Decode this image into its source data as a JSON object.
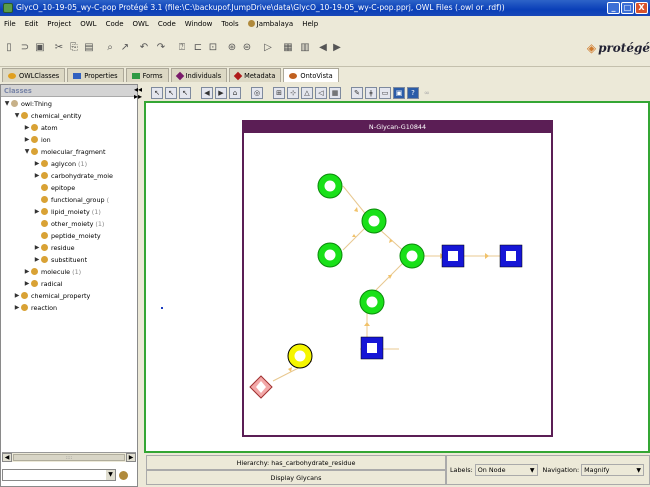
{
  "window": {
    "title": "GlycO_10-19-05_wy-C-pop  Protégé 3.1   (file:\\C:\\backupof.JumpDrive\\data\\GlycO_10-19-05_wy-C-pop.pprj, OWL Files (.owl or .rdf))",
    "minimize": "_",
    "maximize": "□",
    "close": "X"
  },
  "menu": [
    "File",
    "Edit",
    "Project",
    "OWL",
    "Code",
    "OWL",
    "Code",
    "Window",
    "Tools",
    "Jambalaya",
    "Help"
  ],
  "logo": "protégé",
  "tabs": [
    {
      "label": "OWLClasses",
      "color": "#e0a020"
    },
    {
      "label": "Properties",
      "color": "#3060c0"
    },
    {
      "label": "Forms",
      "color": "#2e9a45"
    },
    {
      "label": "Individuals",
      "color": "#7a1a6a"
    },
    {
      "label": "Metadata",
      "color": "#b01a1a"
    },
    {
      "label": "OntoVista",
      "color": "#c06020"
    }
  ],
  "left_panel": {
    "header": "Classes",
    "tree": [
      {
        "label": "owl:Thing",
        "expanded": true
      },
      {
        "label": "chemical_entity",
        "expanded": true
      },
      {
        "label": "atom"
      },
      {
        "label": "ion"
      },
      {
        "label": "molecular_fragment",
        "expanded": true
      },
      {
        "label": "aglycon",
        "count": "(1)"
      },
      {
        "label": "carbohydrate_moie"
      },
      {
        "label": "epitope"
      },
      {
        "label": "functional_group",
        "count": "("
      },
      {
        "label": "lipid_moiety",
        "count": "(1)"
      },
      {
        "label": "other_moiety",
        "count": "(1)"
      },
      {
        "label": "peptide_moiety"
      },
      {
        "label": "residue"
      },
      {
        "label": "substituent"
      },
      {
        "label": "molecule",
        "count": "(1)"
      },
      {
        "label": "radical"
      },
      {
        "label": "chemical_property"
      },
      {
        "label": "reaction"
      }
    ],
    "scroll_thumb_label": "::::"
  },
  "canvas": {
    "glycan_title": "N-Glycan-G10844"
  },
  "status": {
    "hierarchy": "Hierarchy: has_carbohydrate_residue",
    "display_button": "Display Glycans",
    "labels_label": "Labels:",
    "labels_value": "On Node",
    "navigation_label": "Navigation:",
    "navigation_value": "Magnify"
  },
  "colors": {
    "green_node": "#19e019",
    "blue_node": "#1616d6",
    "yellow_node": "#f5f500",
    "edge": "#e8c890",
    "frame": "#5b1e55",
    "canvas_border": "#34a634"
  }
}
